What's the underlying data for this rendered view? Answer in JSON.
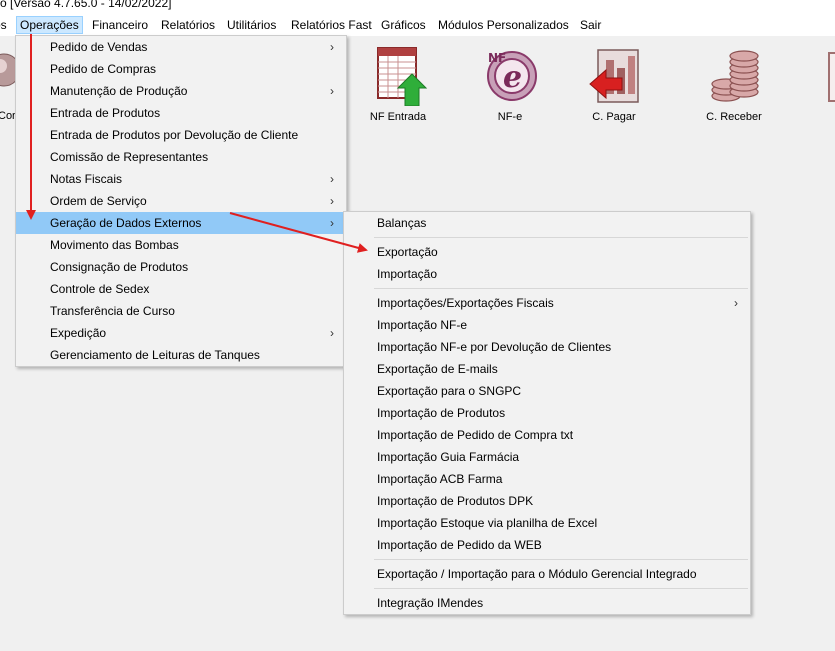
{
  "window": {
    "title_fragment": "o [Versão 4.7.65.0 - 14/02/2022]"
  },
  "menubar": {
    "items": [
      {
        "label": "os"
      },
      {
        "label": "Operações"
      },
      {
        "label": "Financeiro"
      },
      {
        "label": "Relatórios"
      },
      {
        "label": "Utilitários"
      },
      {
        "label": "Relatórios Fast"
      },
      {
        "label": "Gráficos"
      },
      {
        "label": "Módulos Personalizados"
      },
      {
        "label": "Sair"
      }
    ]
  },
  "toolbar": {
    "partial_label": "Cor",
    "items": [
      {
        "label": "NF Entrada",
        "icon": "nf-entrada-icon"
      },
      {
        "label": "NF-e",
        "icon": "nfe-icon"
      },
      {
        "label": "C. Pagar",
        "icon": "contas-pagar-icon"
      },
      {
        "label": "C. Receber",
        "icon": "contas-receber-icon"
      }
    ]
  },
  "operacoes_menu": {
    "items": [
      {
        "label": "Pedido de Vendas",
        "submenu": "›"
      },
      {
        "label": "Pedido de Compras",
        "submenu": ""
      },
      {
        "label": "Manutenção de Produção",
        "submenu": "›"
      },
      {
        "label": "Entrada de Produtos",
        "submenu": ""
      },
      {
        "label": "Entrada de Produtos por Devolução de Cliente",
        "submenu": ""
      },
      {
        "label": "Comissão de Representantes",
        "submenu": ""
      },
      {
        "label": "Notas Fiscais",
        "submenu": "›"
      },
      {
        "label": "Ordem de Serviço",
        "submenu": "›"
      },
      {
        "label": "Geração de Dados Externos",
        "submenu": "›"
      },
      {
        "label": "Movimento das Bombas",
        "submenu": ""
      },
      {
        "label": "Consignação de Produtos",
        "submenu": ""
      },
      {
        "label": "Controle de Sedex",
        "submenu": ""
      },
      {
        "label": "Transferência de Curso",
        "submenu": ""
      },
      {
        "label": "Expedição",
        "submenu": "›"
      },
      {
        "label": "Gerenciamento de Leituras de Tanques",
        "submenu": ""
      }
    ]
  },
  "submenu": {
    "items": [
      {
        "label": "Balanças",
        "submenu": ""
      },
      {
        "label": "Exportação",
        "submenu": ""
      },
      {
        "label": "Importação",
        "submenu": ""
      },
      {
        "label": "Importações/Exportações Fiscais",
        "submenu": "›"
      },
      {
        "label": "Importação NF-e",
        "submenu": ""
      },
      {
        "label": "Importação NF-e por Devolução de Clientes",
        "submenu": ""
      },
      {
        "label": "Exportação de E-mails",
        "submenu": ""
      },
      {
        "label": "Exportação para o SNGPC",
        "submenu": ""
      },
      {
        "label": "Importação de Produtos",
        "submenu": ""
      },
      {
        "label": "Importação de Pedido de Compra txt",
        "submenu": ""
      },
      {
        "label": "Importação Guia Farmácia",
        "submenu": ""
      },
      {
        "label": "Importação ACB Farma",
        "submenu": ""
      },
      {
        "label": "Importação de Produtos DPK",
        "submenu": ""
      },
      {
        "label": "Importação Estoque via planilha de Excel",
        "submenu": ""
      },
      {
        "label": "Importação de Pedido da WEB",
        "submenu": ""
      },
      {
        "label": "Exportação / Importação para o Módulo Gerencial Integrado",
        "submenu": ""
      },
      {
        "label": "Integração IMendes",
        "submenu": ""
      }
    ]
  },
  "colors": {
    "highlight": "#91c9f7",
    "menubar_active": "#cce8ff",
    "annotation_arrow": "#e02020"
  }
}
